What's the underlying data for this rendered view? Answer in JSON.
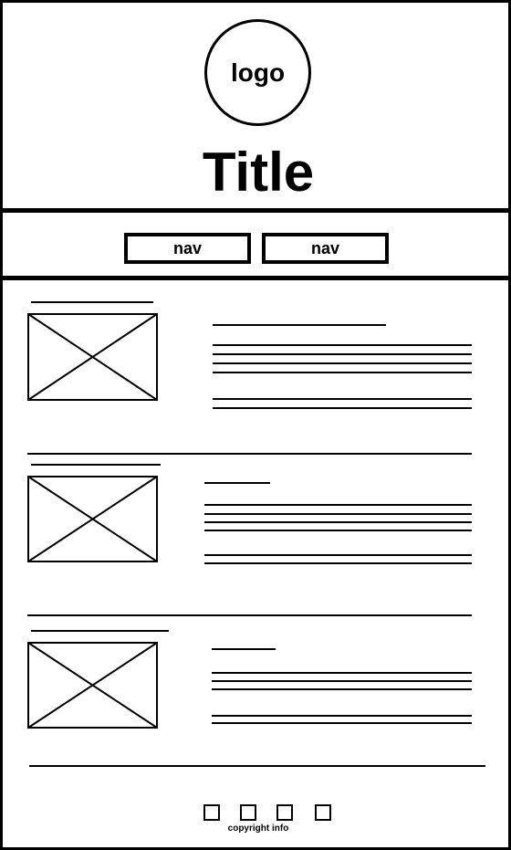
{
  "header": {
    "logo_label": "logo",
    "title": "Title"
  },
  "nav": {
    "items": [
      {
        "label": "nav"
      },
      {
        "label": "nav"
      }
    ]
  },
  "content": {
    "articles": [
      {
        "image_placeholder": "image-placeholder"
      },
      {
        "image_placeholder": "image-placeholder"
      },
      {
        "image_placeholder": "image-placeholder"
      }
    ]
  },
  "footer": {
    "social_icons": [
      "square-icon",
      "square-icon",
      "square-icon",
      "square-icon"
    ],
    "copyright": "copyright info"
  }
}
